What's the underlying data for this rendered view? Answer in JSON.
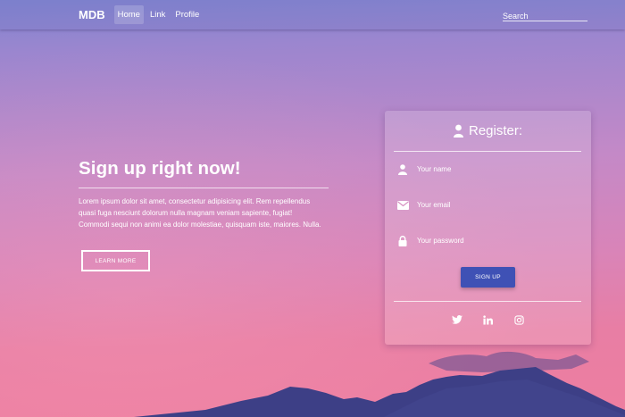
{
  "navbar": {
    "brand": "MDB",
    "links": [
      {
        "label": "Home",
        "active": true
      },
      {
        "label": "Link",
        "active": false
      },
      {
        "label": "Profile",
        "active": false
      }
    ],
    "search_placeholder": "Search"
  },
  "hero": {
    "title": "Sign up right now!",
    "text_lines": [
      "Lorem ipsum dolor sit amet, consectetur adipisicing elit. Rem repellendus",
      "quasi fuga nesciunt dolorum nulla magnam veniam sapiente, fugiat!",
      "Commodi sequi non animi ea dolor molestiae, quisquam iste, maiores. Nulla."
    ],
    "button_label": "LEARN MORE"
  },
  "register": {
    "title": "Register:",
    "icon": "user-icon",
    "fields": [
      {
        "icon": "user-icon",
        "placeholder": "Your name"
      },
      {
        "icon": "envelope-icon",
        "placeholder": "Your email"
      },
      {
        "icon": "lock-icon",
        "placeholder": "Your password"
      }
    ],
    "submit_label": "SIGN UP",
    "socials": [
      "twitter-icon",
      "linkedin-icon",
      "instagram-icon"
    ]
  },
  "colors": {
    "button": "#3f51b5",
    "sky_top": "#7f84d0",
    "sky_bottom": "#ee7ea0",
    "mountain": "#3d3f86"
  }
}
